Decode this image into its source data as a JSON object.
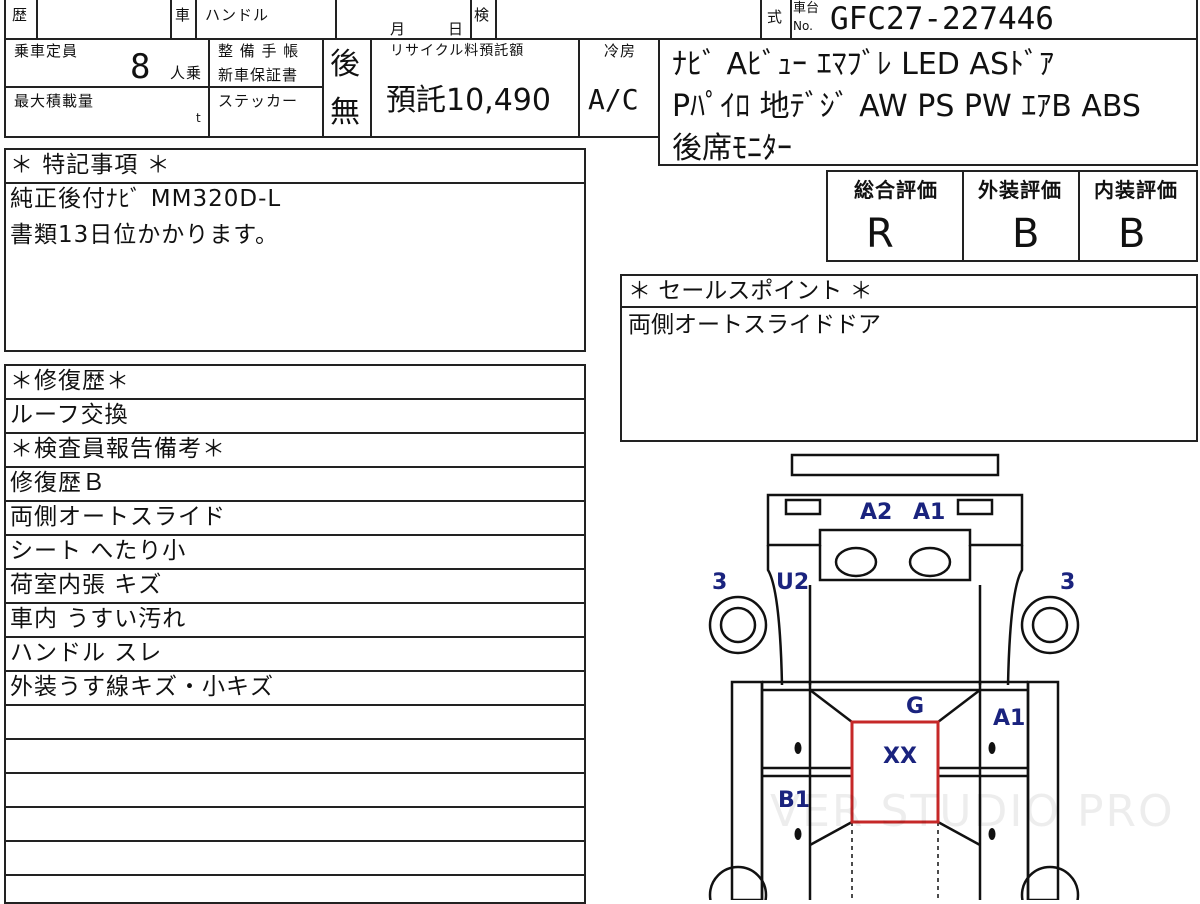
{
  "header": {
    "history_label": "歴",
    "car_label": "車",
    "handle_label": "ハンドル",
    "month_label": "月",
    "day_label": "日",
    "inspection_label": "検",
    "type_label": "式",
    "chassis_label_1": "車台",
    "chassis_label_2": "No.",
    "chassis_number": "GFC27-227446"
  },
  "specs": {
    "capacity_label": "乗車定員",
    "capacity_value": "8",
    "capacity_unit": "人乗",
    "maintenance_label_1": "整 備 手 帳",
    "maintenance_label_2": "新車保証書",
    "maintenance_value": "後",
    "max_load_label": "最大積載量",
    "max_load_unit": "t",
    "sticker_label": "ステッカー",
    "sticker_value": "無",
    "recycle_label": "リサイクル料預託額",
    "recycle_value": "預託10,490",
    "cooler_label": "冷房",
    "cooler_value": "A/C"
  },
  "equipment": [
    "ﾅﾋﾞ Aﾋﾞｭｰ ｴﾏﾌﾞﾚ LED ASﾄﾞｱ",
    "Pﾊﾟｲﾛ 地ﾃﾞｼﾞ AW PS PW ｴｱB ABS",
    "後席ﾓﾆﾀｰ"
  ],
  "ratings": {
    "overall_label": "総合評価",
    "overall_value": "R",
    "exterior_label": "外装評価",
    "exterior_value": "B",
    "interior_label": "内装評価",
    "interior_value": "B"
  },
  "special_notes": {
    "title": "＊ 特記事項 ＊",
    "lines": [
      "純正後付ﾅﾋﾞ MM320D-L",
      "書類13日位かかります。"
    ]
  },
  "sales_points": {
    "title": "＊ セールスポイント ＊",
    "lines": [
      "両側オートスライドドア"
    ]
  },
  "repair_history": {
    "title": "＊修復歴＊",
    "lines": [
      "ルーフ交換"
    ]
  },
  "inspector_notes": {
    "title": "＊検査員報告備考＊",
    "lines": [
      "修復歴Ｂ",
      "両側オートスライド",
      "シート へたり小",
      "荷室内張 キズ",
      "車内 うすい汚れ",
      "ハンドル スレ",
      "外装うす線キズ・小キズ"
    ]
  },
  "diagram": {
    "marks": {
      "a2": "A2",
      "a1_top": "A1",
      "left_3": "3",
      "u2": "U2",
      "right_3": "3",
      "g": "G",
      "a1_right": "A1",
      "xx": "XX",
      "b1": "B1"
    },
    "mark_color": "#1a237e",
    "repair_box_color": "#c62828"
  },
  "watermark": "VER STUDIO PRO"
}
